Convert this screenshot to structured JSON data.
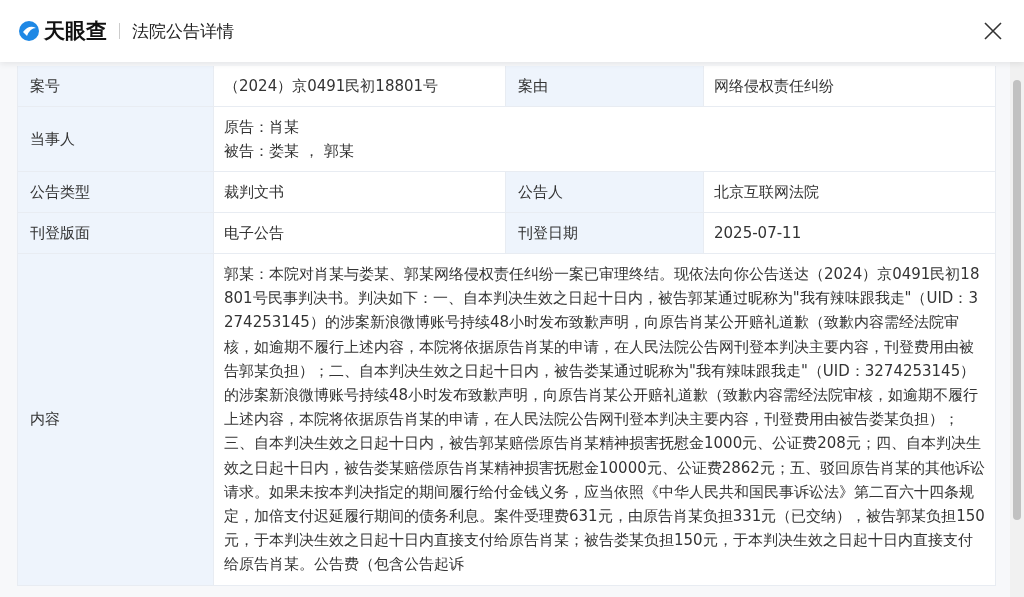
{
  "header": {
    "logo_text": "天眼查",
    "title": "法院公告详情"
  },
  "rows": [
    {
      "kind": "pair",
      "label": "案号",
      "value": "（2024）京0491民初18801号",
      "label2": "案由",
      "value2": "网络侵权责任纠纷"
    },
    {
      "kind": "lines",
      "label": "当事人",
      "lines": [
        "原告：肖某",
        "被告：娄某 ， 郭某"
      ]
    },
    {
      "kind": "pair",
      "label": "公告类型",
      "value": "裁判文书",
      "label2": "公告人",
      "value2": "北京互联网法院"
    },
    {
      "kind": "pair",
      "label": "刊登版面",
      "value": "电子公告",
      "label2": "刊登日期",
      "value2": "2025-07-11"
    },
    {
      "kind": "text",
      "label": "内容",
      "text": "郭某：本院对肖某与娄某、郭某网络侵权责任纠纷一案已审理终结。现依法向你公告送达（2024）京0491民初18801号民事判决书。判决如下：一、自本判决生效之日起十日内，被告郭某通过昵称为\"我有辣味跟我走\"（UID：3274253145）的涉案新浪微博账号持续48小时发布致歉声明，向原告肖某公开赔礼道歉（致歉内容需经法院审核，如逾期不履行上述内容，本院将依据原告肖某的申请，在人民法院公告网刊登本判决主要内容，刊登费用由被告郭某负担）；二、自本判决生效之日起十日内，被告娄某通过昵称为\"我有辣味跟我走\"（UID：3274253145）的涉案新浪微博账号持续48小时发布致歉声明，向原告肖某公开赔礼道歉（致歉内容需经法院审核，如逾期不履行上述内容，本院将依据原告肖某的申请，在人民法院公告网刊登本判决主要内容，刊登费用由被告娄某负担）；三、自本判决生效之日起十日内，被告郭某赔偿原告肖某精神损害抚慰金1000元、公证费208元；四、自本判决生效之日起十日内，被告娄某赔偿原告肖某精神损害抚慰金10000元、公证费2862元；五、驳回原告肖某的其他诉讼请求。如果未按本判决指定的期间履行给付金钱义务，应当依照《中华人民共和国民事诉讼法》第二百六十四条规定，加倍支付迟延履行期间的债务利息。案件受理费631元，由原告肖某负担331元（已交纳），被告郭某负担150元，于本判决生效之日起十日内直接支付给原告肖某；被告娄某负担150元，于本判决生效之日起十日内直接支付给原告肖某。公告费（包含公告起诉"
    }
  ]
}
